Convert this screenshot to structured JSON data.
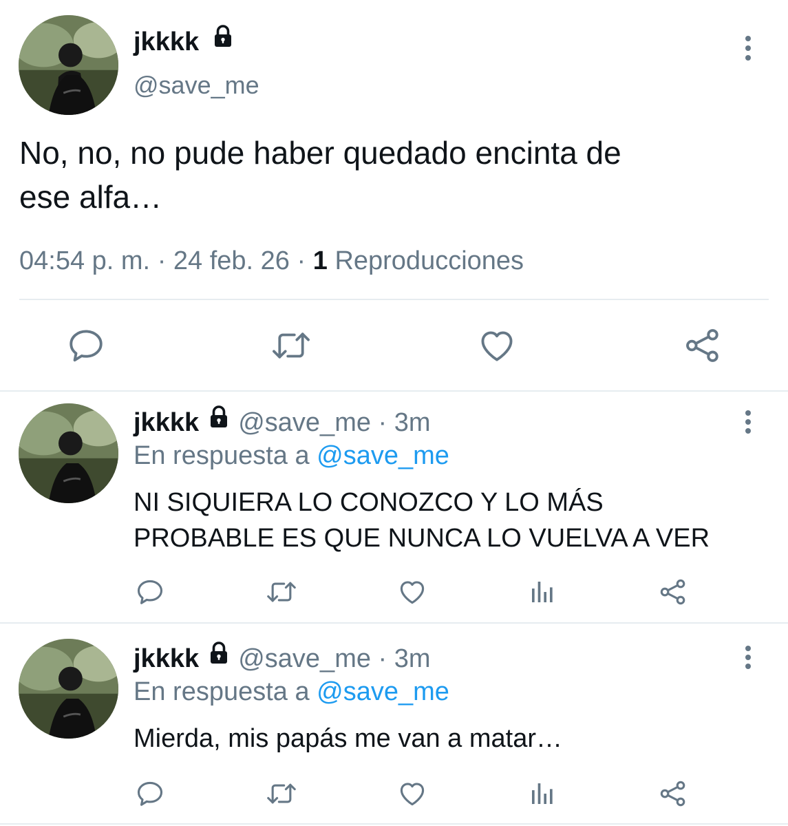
{
  "main_tweet": {
    "display_name": "jkkkk",
    "handle": "@save_me",
    "text_line1": "No, no, no pude haber quedado encinta de",
    "text_line2": "ese alfa…",
    "time": "04:54 p. m.",
    "sep1": "·",
    "date": "24 feb. 26",
    "sep2": "·",
    "views_count": "1",
    "views_label": "Reproducciones"
  },
  "replies": [
    {
      "display_name": "jkkkk",
      "handle": "@save_me",
      "sep": "·",
      "age": "3m",
      "reply_prefix": "En respuesta a",
      "reply_to": "@save_me",
      "text_line1": "NI SIQUIERA LO CONOZCO Y LO MÁS",
      "text_line2": "PROBABLE ES QUE NUNCA LO VUELVA A VER"
    },
    {
      "display_name": "jkkkk",
      "handle": "@save_me",
      "sep": "·",
      "age": "3m",
      "reply_prefix": "En respuesta a",
      "reply_to": "@save_me",
      "text_line1": "Mierda, mis papás me van a matar…"
    }
  ],
  "icons": {
    "reply": "comment-bubble-icon",
    "retweet": "retweet-icon",
    "like": "heart-icon",
    "analytics": "bar-chart-icon",
    "share": "share-icon",
    "more": "vertical-dots-icon",
    "protected": "lock-icon"
  },
  "colors": {
    "text": "#0f1419",
    "muted": "#657786",
    "link": "#1d9bf0",
    "divider": "#e6ecf0"
  }
}
